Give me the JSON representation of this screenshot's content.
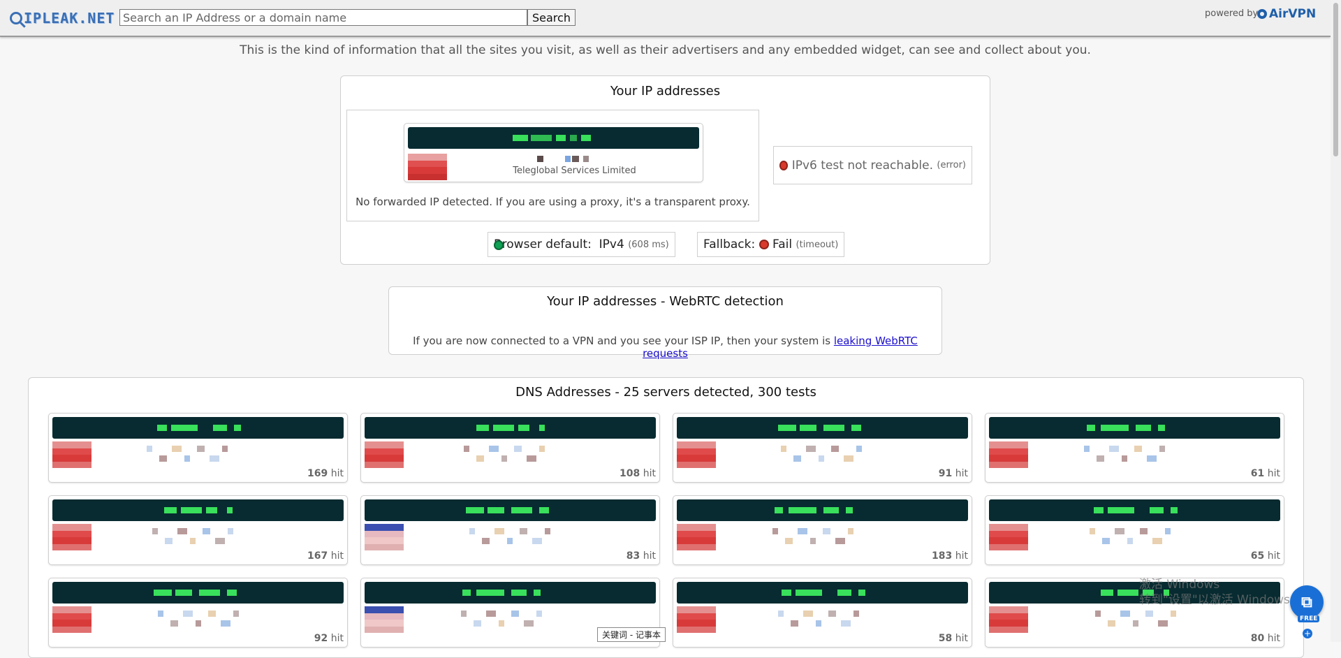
{
  "header": {
    "logo_text": "IPLEAK.NET",
    "search_placeholder": "Search an IP Address or a domain name",
    "search_button": "Search",
    "powered_by": "powered by",
    "brand": "AirVPN"
  },
  "intro": "This is the kind of information that all the sites you visit, as well as their advertisers and any embedded widget, can see and collect about you.",
  "ip_section": {
    "title": "Your IP addresses",
    "isp": "Teleglobal Services Limited",
    "no_forward": "No forwarded IP detected. If you are using a proxy, it's a transparent proxy.",
    "ipv6_status": "IPv6 test not reachable.",
    "ipv6_detail": "(error)",
    "browser_default_label": "Browser default:",
    "browser_default_value": "IPv4",
    "browser_default_time": "(608 ms)",
    "fallback_label": "Fallback:",
    "fallback_value": "Fail",
    "fallback_detail": "(timeout)"
  },
  "webrtc": {
    "title": "Your IP addresses - WebRTC detection",
    "note": "If you are now connected to a VPN and you see your ISP IP, then your system is",
    "link": "leaking WebRTC requests"
  },
  "dns": {
    "title": "DNS Addresses - 25 servers detected, 300 tests",
    "hit_suffix": "hit",
    "cards": [
      {
        "hits": "169",
        "flag": "red"
      },
      {
        "hits": "108",
        "flag": "red"
      },
      {
        "hits": "91",
        "flag": "red"
      },
      {
        "hits": "61",
        "flag": "red"
      },
      {
        "hits": "167",
        "flag": "red"
      },
      {
        "hits": "83",
        "flag": "us"
      },
      {
        "hits": "183",
        "flag": "red"
      },
      {
        "hits": "65",
        "flag": "red"
      },
      {
        "hits": "92",
        "flag": "red"
      },
      {
        "hits": "",
        "flag": "us"
      },
      {
        "hits": "58",
        "flag": "red"
      },
      {
        "hits": "80",
        "flag": "red"
      }
    ]
  },
  "overlay": {
    "toast": "关键词 - 记事本",
    "watermark_line1": "激活 Windows",
    "watermark_line2": "转到\"设置\"以激活 Windows。",
    "badge_label": "FREE"
  },
  "colors": {
    "ip_bar": "#072b30",
    "ip_redact": "#39e05b",
    "link": "#1a0dcc",
    "status_ok": "#10a155",
    "status_fail": "#d93a2b"
  }
}
